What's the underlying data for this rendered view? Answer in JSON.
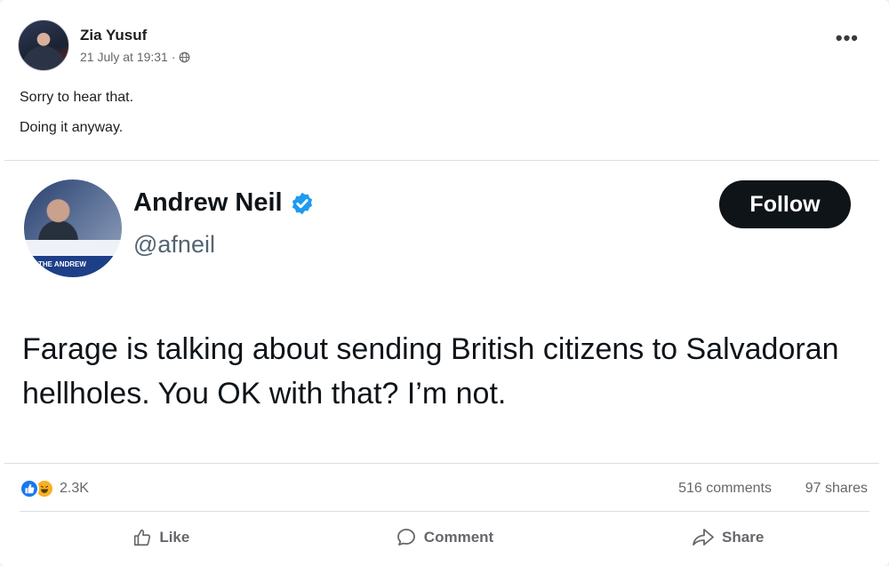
{
  "post": {
    "author": "Zia Yusuf",
    "timestamp": "21 July at 19:31 ·",
    "text_lines": [
      "Sorry to hear that.",
      "Doing it anyway."
    ]
  },
  "tweet": {
    "name": "Andrew Neil",
    "handle": "@afneil",
    "follow_label": "Follow",
    "avatar_text": "THE ANDREW",
    "body": "Farage is talking about sending British citizens to Salvadoran hellholes. You OK with that? I’m not."
  },
  "engagement": {
    "reaction_count": "2.3K",
    "comments": "516 comments",
    "shares": "97 shares"
  },
  "actions": {
    "like": "Like",
    "comment": "Comment",
    "share": "Share"
  },
  "icons": [
    "globe-icon",
    "more-options-icon",
    "verified-badge-icon",
    "like-reaction-icon",
    "haha-reaction-icon",
    "thumbs-up-icon",
    "comment-bubble-icon",
    "share-arrow-icon"
  ],
  "colors": {
    "verified": "#1d9bf0",
    "like_blue": "#1877f2",
    "follow_bg": "#0f1419"
  }
}
